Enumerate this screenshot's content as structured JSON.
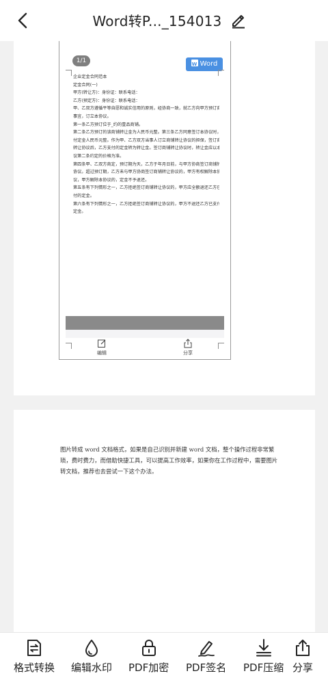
{
  "header": {
    "title": "Word转P..._154013"
  },
  "preview": {
    "page_badge": "1/1",
    "word_button": "Word",
    "lines": [
      "企业定金合同范本",
      "定金合同(一)",
      "甲方(转让方)：身份证：联系电话：",
      "乙方(预定方)：身份证：联系电话：",
      "甲、乙双方遵循平等自愿和诚实信用的原则，经协商一致，就乙方向甲方预订商铺",
      "事宜，订立本协议。",
      "第一条乙方预订位于_约的壹品商铺。",
      "第二条乙方预订的该商铺转让金为人民币元整。第三条乙方同意签订本协议时，支",
      "付定金人民币元整。作为甲、乙方双方当事人订立商铺转让协议的担保，签订商铺",
      "转让协议后，乙方支付的定金转为转让金。签订商铺转让协议时，转让金应以本协",
      "议第二条约定的价格为准。",
      "第四条甲、乙双方商定，预订期为天，乙方于年月日前，与甲方协商签订商铺转让",
      "协议。超过预订期，乙方未与甲方协商签订商铺转让协议的，甲方有权解除本协",
      "议，甲方解除本协议的，定金不予退还。",
      "第五条有下列情形之一，乙方拒绝签订商铺转让协议的，甲方应全额退还乙方已支",
      "付的定金。",
      "第六条有下列情形之一，乙方拒绝签订商铺转让协议的，甲方不退还乙方已支付的",
      "定金。"
    ],
    "actions": {
      "edit": "编辑",
      "share": "分享"
    }
  },
  "page2": {
    "text": "图片转成 word 文档格式，如果是自己识别并新建 word 文档，整个操作过程非常繁琐，费时费力，而借助快捷工具，可以提高工作效率，如果你在工作过程中，需要图片转文档，推荐也去尝试一下这个办法。"
  },
  "toolbar": {
    "items": [
      {
        "label": "格式转换",
        "icon": "format-convert-icon"
      },
      {
        "label": "编辑水印",
        "icon": "watermark-drop-icon"
      },
      {
        "label": "PDF加密",
        "icon": "lock-icon"
      },
      {
        "label": "PDF签名",
        "icon": "signature-pen-icon"
      },
      {
        "label": "PDF压缩",
        "icon": "compress-download-icon"
      },
      {
        "label": "分享",
        "icon": "share-icon"
      }
    ]
  },
  "colors": {
    "accent_blue": "#4a90e2",
    "background": "#f1f1f1"
  }
}
